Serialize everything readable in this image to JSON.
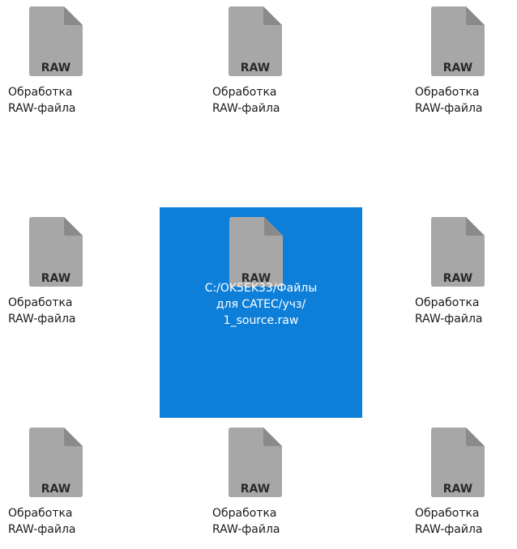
{
  "icon_text": "RAW",
  "file_label_line1": "Обработка",
  "file_label_line2": "RAW-файла",
  "selected": {
    "icon_text": "RAW",
    "path_line1": "C:/OK5EK33/Файлы",
    "path_line2": "для CATEC/учз/",
    "path_line3": "1_source.raw"
  },
  "colors": {
    "icon_body": "#a7a7a7",
    "icon_fold": "#8a8a8a",
    "icon_text": "#2a2a2a",
    "selection": "#0e7fd8"
  },
  "files": [
    {
      "label1": "Обработка",
      "label2": "RAW-файла",
      "icon_text": "RAW"
    },
    {
      "label1": "Обработка",
      "label2": "RAW-файла",
      "icon_text": "RAW"
    },
    {
      "label1": "Обработка",
      "label2": "RAW-файла",
      "icon_text": "RAW"
    },
    {
      "label1": "Обработка",
      "label2": "RAW-файла",
      "icon_text": "RAW"
    },
    {
      "label1": "Обработка",
      "label2": "RAW-файла",
      "icon_text": "RAW"
    },
    {
      "label1": "Обработка",
      "label2": "RAW-файла",
      "icon_text": "RAW"
    },
    {
      "label1": "Обработка",
      "label2": "RAW-файла",
      "icon_text": "RAW"
    },
    {
      "label1": "Обработка",
      "label2": "RAW-файла",
      "icon_text": "RAW"
    }
  ]
}
